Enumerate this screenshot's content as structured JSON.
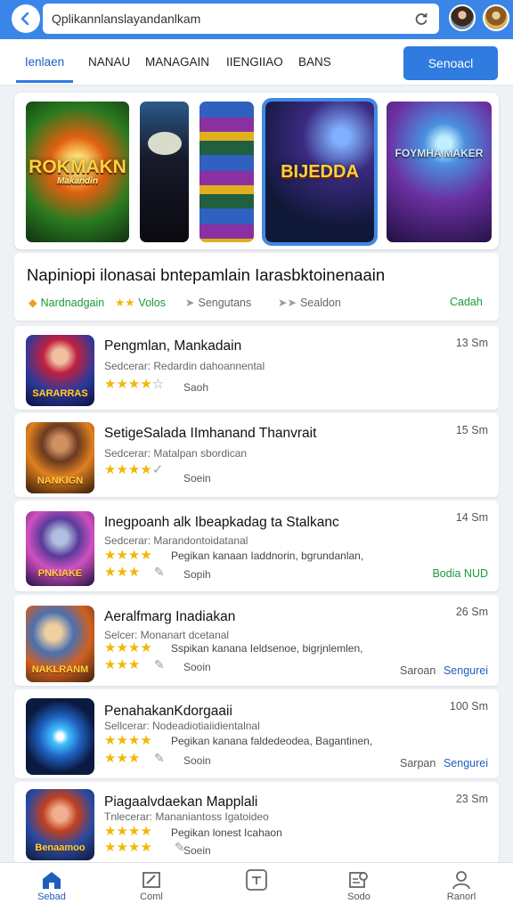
{
  "search": {
    "value": "Qplikannlanslayandanlkam"
  },
  "tabs": [
    "Ienlaen",
    "NANAU",
    "MANAGAIN",
    "IIENGIIAO",
    "BANS"
  ],
  "action_button": "Senoacl",
  "banner": {
    "cards": [
      "ROKMAKN",
      "",
      "",
      "BIJEDDA",
      "FOYMHA MAKER"
    ],
    "card_sub": "Makandin"
  },
  "headline": {
    "title": "Napiniopi ilonasai bntepamlain Iarasbktoinenaain",
    "tag1": "Nardnadgain",
    "tag2": "Volos",
    "tag3": "Sengutans",
    "tag4": "Sealdon",
    "tag5": "Cadah"
  },
  "items": [
    {
      "title": "Pengmlan, Mankadain",
      "size": "13 Sm",
      "sub": "Sedcerar: Redardin dahoannental",
      "desc": "",
      "dur": "Saoh",
      "rating": 4,
      "action_grey": "",
      "action_blue": "",
      "action_green": "",
      "thumb": "SARARRAS"
    },
    {
      "title": "SetigeSalada IImhanand Thanvrait",
      "size": "15 Sm",
      "sub": "Sedcerar: Matalpan sbordican",
      "desc": "",
      "dur": "Soein",
      "rating": 4,
      "action_grey": "",
      "action_blue": "",
      "action_green": "",
      "thumb": "NANKIGN"
    },
    {
      "title": "Inegpoanh alk Ibeapkadag ta Stalkanc",
      "size": "14 Sm",
      "sub": "Sedcerar: Marandontoidatanal",
      "desc": "Pegikan kanaan Iaddnorin, bgrundanlan,",
      "dur": "Sopih",
      "rating": 3,
      "action_grey": "",
      "action_blue": "",
      "action_green": "Bodia NUD",
      "thumb": "PNKIAKE"
    },
    {
      "title": "Aeralfmarg Inadiakan",
      "size": "26 Sm",
      "sub": "Selcer: Monanart dcetanal",
      "desc": "Sspikan kanana Ieldsenoe, bigrjnlemlen,",
      "dur": "Sooin",
      "rating": 3,
      "action_grey": "Saroan",
      "action_blue": "Sengurei",
      "action_green": "",
      "thumb": "NAKLRANM"
    },
    {
      "title": "PenahakanKdorgaaii",
      "size": "100 Sm",
      "sub": "Sellcerar: Nodeadiotiaiidientalnal",
      "desc": "Pegikan kanana faldedeodea, Bagantinen,",
      "dur": "Sooin",
      "rating": 3,
      "action_grey": "Sarpan",
      "action_blue": "Sengurei",
      "action_green": "",
      "thumb": ""
    },
    {
      "title": "Piagaalvdaekan Mapplali",
      "size": "23 Sm",
      "sub": "Tnlecerar: Mananiantoss Igatoideo",
      "desc": "Pegikan lonest Icahaon",
      "dur": "Soein",
      "rating": 4,
      "action_grey": "",
      "action_blue": "",
      "action_green": "",
      "thumb": "Benaamoo"
    }
  ],
  "nav": [
    "Sebad",
    "Coml",
    "",
    "Sodo",
    "Ranorl"
  ]
}
